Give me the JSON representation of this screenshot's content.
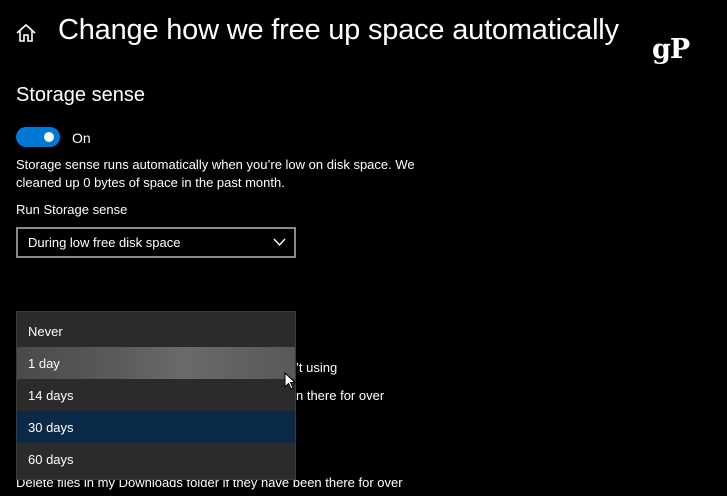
{
  "header": {
    "title": "Change how we free up space automatically",
    "logo_text": "gP"
  },
  "storage_sense": {
    "section_title": "Storage sense",
    "toggle_state": "On",
    "description": "Storage sense runs automatically when you’re low on disk space. We cleaned up 0 bytes of space in the past month.",
    "run_label": "Run Storage sense",
    "run_value": "During low free disk space"
  },
  "background_text": {
    "line1": "’t using",
    "line2": "n there for over",
    "line3": "Delete files in my Downloads folder if they have been there for over"
  },
  "dropdown": {
    "options": [
      "Never",
      "1 day",
      "14 days",
      "30 days",
      "60 days"
    ],
    "hovered_index": 1,
    "selected_index": 3
  },
  "colors": {
    "accent": "#0078d7",
    "background": "#000000",
    "dropdown_bg": "#2b2b2b",
    "selected_bg": "#0a2a47"
  }
}
